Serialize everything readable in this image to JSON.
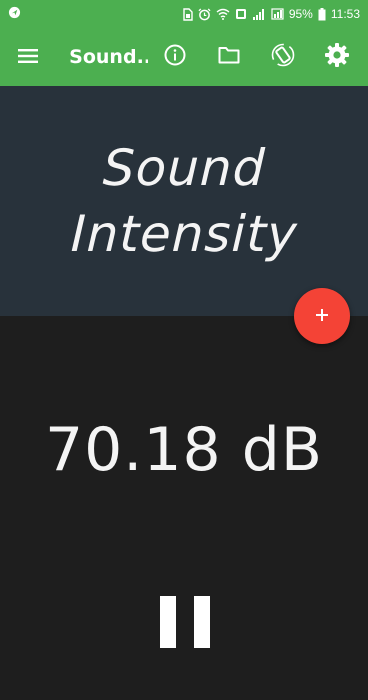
{
  "status_bar": {
    "battery_percent": "95%",
    "time": "11:53",
    "icons": [
      "location-icon",
      "sim-icon",
      "alarm-icon",
      "wifi-icon",
      "notification-icon",
      "signal-icon",
      "signal-icon",
      "battery-icon"
    ]
  },
  "app_bar": {
    "title": "Sound...",
    "actions": [
      "info-icon",
      "folder-icon",
      "screen-rotation-icon",
      "settings-icon"
    ]
  },
  "header": {
    "line1": "Sound",
    "line2": "Intensity"
  },
  "fab": {
    "label": "+"
  },
  "reading": {
    "value": "70.18 dB"
  },
  "colors": {
    "app_bar": "#4caf50",
    "header_bg": "#28323b",
    "body_bg": "#1e1e1e",
    "fab": "#f44336",
    "text": "#f4f4f4"
  }
}
